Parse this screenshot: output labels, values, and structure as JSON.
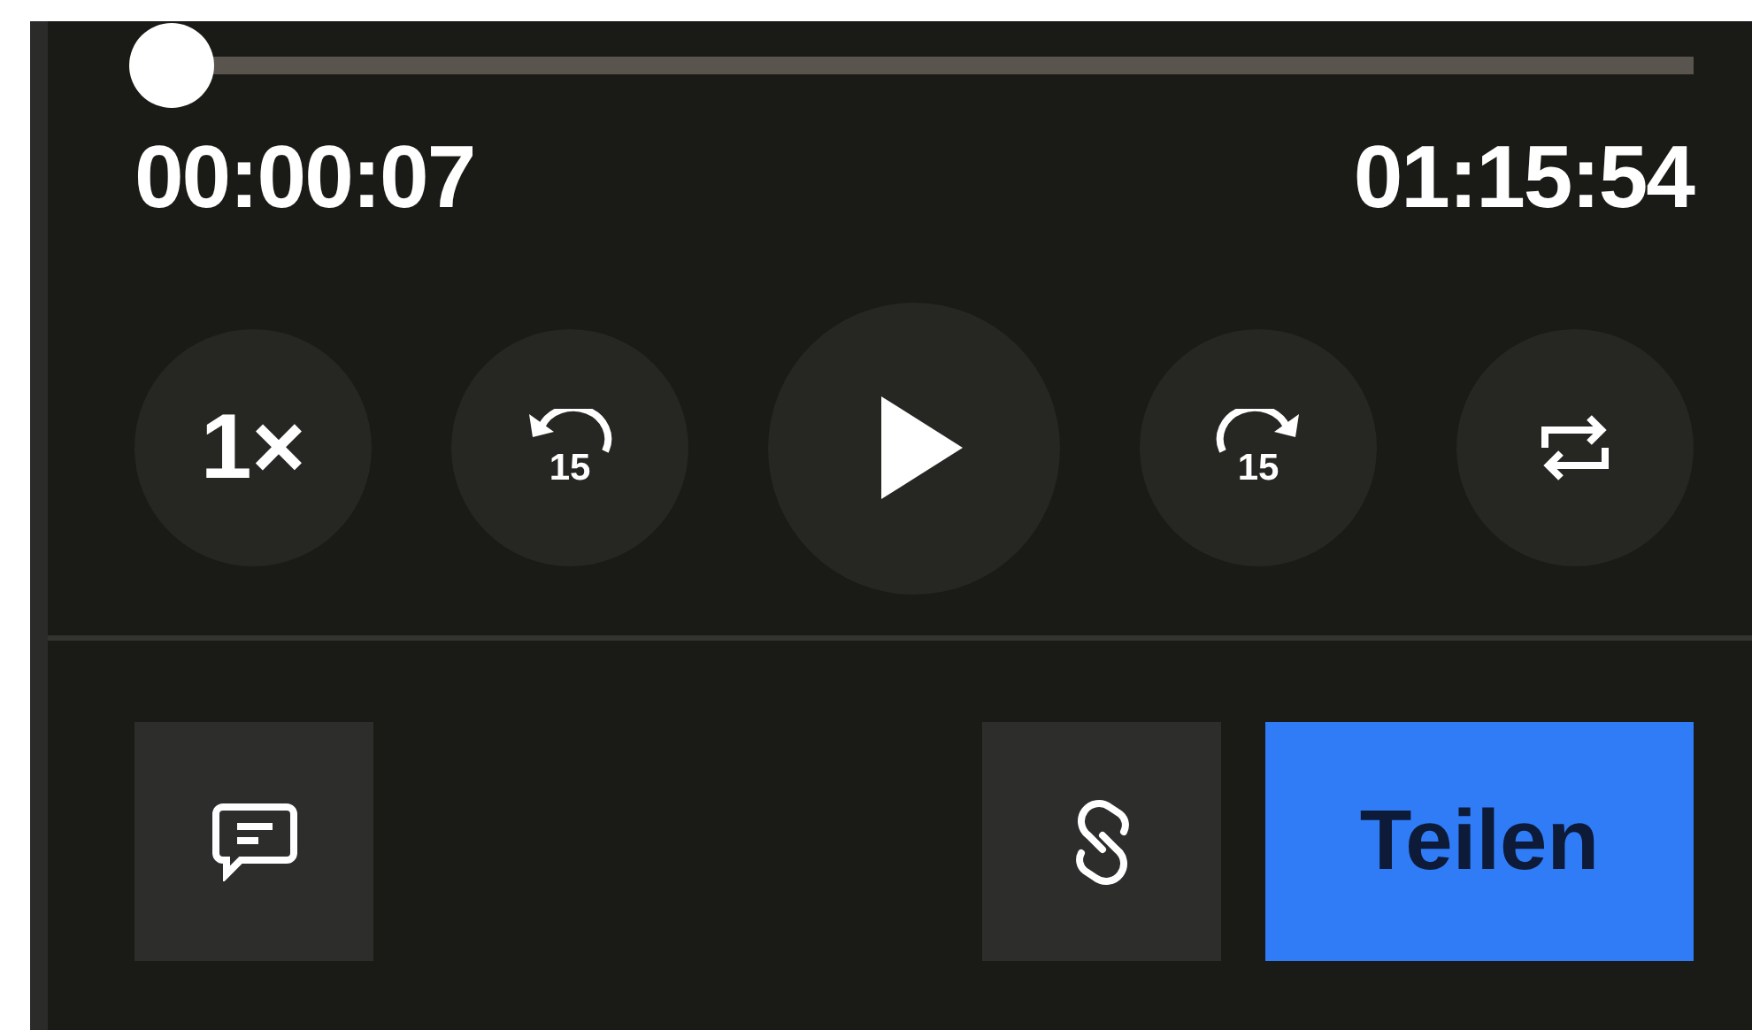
{
  "progress": {
    "level": 0.002
  },
  "elapsed": "00:00:07",
  "duration": "01:15:54",
  "controls": [
    {
      "kind": "speed",
      "label": "1×"
    },
    {
      "kind": "rewind",
      "label": "15"
    },
    {
      "kind": "play"
    },
    {
      "kind": "forward",
      "label": "15"
    },
    {
      "kind": "repeat"
    }
  ],
  "actions": [
    {
      "kind": "comment"
    },
    {
      "kind": "link"
    },
    {
      "kind": "share",
      "label": "Teilen"
    }
  ]
}
